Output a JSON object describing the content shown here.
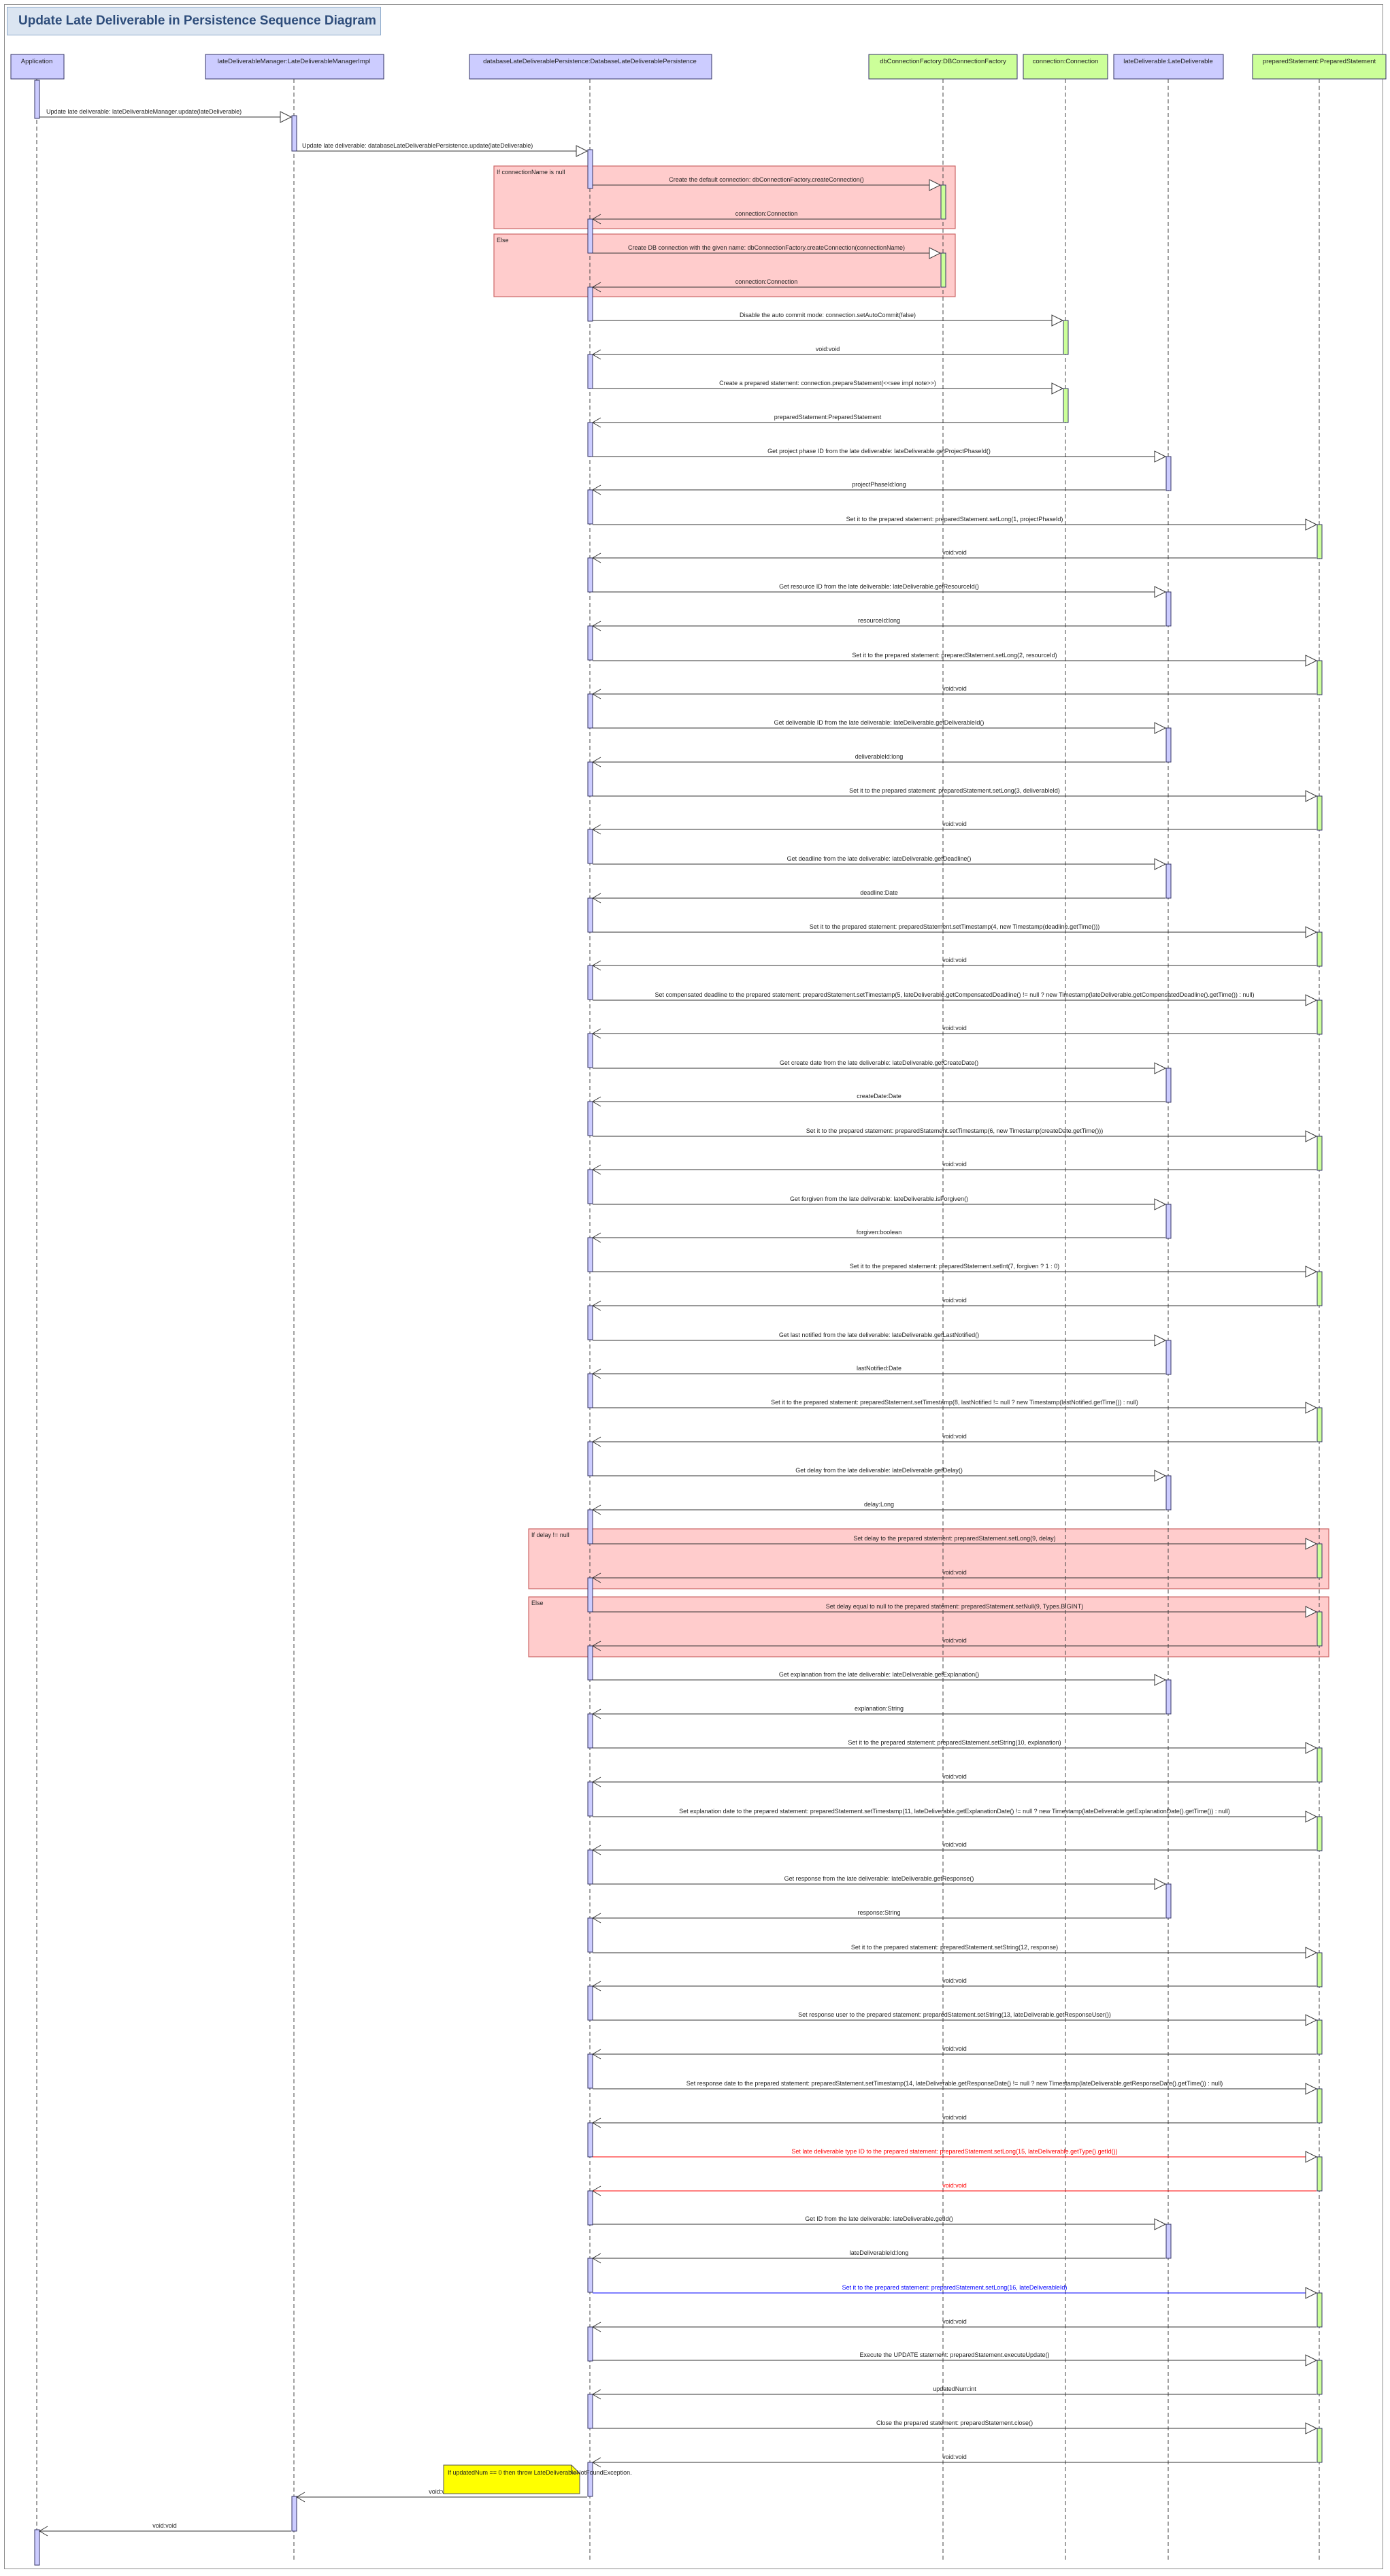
{
  "diagram": {
    "title": "Update Late Deliverable in Persistence Sequence Diagram",
    "colors": {
      "lifeline_blue": "#ccccff",
      "lifeline_green": "#ccff99",
      "fragment_fill": "#ffcccc",
      "fragment_border": "#cc6666",
      "note_fill": "#ffff00",
      "highlight_red": "#ff0000",
      "highlight_blue": "#0000ff"
    },
    "lifelines": [
      {
        "id": "app",
        "label": "Application",
        "color": "blue"
      },
      {
        "id": "mgr",
        "label": "lateDeliverableManager:LateDeliverableManagerImpl",
        "color": "blue"
      },
      {
        "id": "dbp",
        "label": "databaseLateDeliverablePersistence:DatabaseLateDeliverablePersistence",
        "color": "blue"
      },
      {
        "id": "dcf",
        "label": "dbConnectionFactory:DBConnectionFactory",
        "color": "green"
      },
      {
        "id": "con",
        "label": "connection:Connection",
        "color": "green"
      },
      {
        "id": "ld",
        "label": "lateDeliverable:LateDeliverable",
        "color": "blue"
      },
      {
        "id": "ps",
        "label": "preparedStatement:PreparedStatement",
        "color": "green"
      }
    ],
    "fragments": [
      {
        "guard": "If connectionName is null"
      },
      {
        "guard": "Else"
      },
      {
        "guard": "If delay != null"
      },
      {
        "guard": "Else"
      }
    ],
    "note": {
      "text": "If updatedNum == 0 then throw LateDeliverableNotFoundException."
    },
    "messages": [
      {
        "from": "app",
        "to": "mgr",
        "kind": "call",
        "text": "Update late deliverable: lateDeliverableManager.update(lateDeliverable)"
      },
      {
        "from": "mgr",
        "to": "dbp",
        "kind": "call",
        "text": "Update late deliverable: databaseLateDeliverablePersistence.update(lateDeliverable)"
      },
      {
        "from": "dbp",
        "to": "dcf",
        "kind": "call",
        "text": "Create the default connection: dbConnectionFactory.createConnection()"
      },
      {
        "from": "dcf",
        "to": "dbp",
        "kind": "return",
        "text": "connection:Connection"
      },
      {
        "from": "dbp",
        "to": "dcf",
        "kind": "call",
        "text": "Create DB connection with the given name: dbConnectionFactory.createConnection(connectionName)"
      },
      {
        "from": "dcf",
        "to": "dbp",
        "kind": "return",
        "text": "connection:Connection"
      },
      {
        "from": "dbp",
        "to": "con",
        "kind": "call",
        "text": "Disable the auto commit mode: connection.setAutoCommit(false)"
      },
      {
        "from": "con",
        "to": "dbp",
        "kind": "return",
        "text": "void:void"
      },
      {
        "from": "dbp",
        "to": "con",
        "kind": "call",
        "text": "Create a prepared statement: connection.prepareStatement(<<see impl note>>)"
      },
      {
        "from": "con",
        "to": "dbp",
        "kind": "return",
        "text": "preparedStatement:PreparedStatement"
      },
      {
        "from": "dbp",
        "to": "ld",
        "kind": "call",
        "text": "Get project phase ID from the late deliverable: lateDeliverable.getProjectPhaseId()"
      },
      {
        "from": "ld",
        "to": "dbp",
        "kind": "return",
        "text": "projectPhaseId:long"
      },
      {
        "from": "dbp",
        "to": "ps",
        "kind": "call",
        "text": "Set it to the prepared statement: preparedStatement.setLong(1, projectPhaseId)"
      },
      {
        "from": "ps",
        "to": "dbp",
        "kind": "return",
        "text": "void:void"
      },
      {
        "from": "dbp",
        "to": "ld",
        "kind": "call",
        "text": "Get resource ID from the late deliverable: lateDeliverable.getResourceId()"
      },
      {
        "from": "ld",
        "to": "dbp",
        "kind": "return",
        "text": "resourceId:long"
      },
      {
        "from": "dbp",
        "to": "ps",
        "kind": "call",
        "text": "Set it to the prepared statement: preparedStatement.setLong(2, resourceId)"
      },
      {
        "from": "ps",
        "to": "dbp",
        "kind": "return",
        "text": "void:void"
      },
      {
        "from": "dbp",
        "to": "ld",
        "kind": "call",
        "text": "Get deliverable ID from the late deliverable: lateDeliverable.getDeliverableId()"
      },
      {
        "from": "ld",
        "to": "dbp",
        "kind": "return",
        "text": "deliverableId:long"
      },
      {
        "from": "dbp",
        "to": "ps",
        "kind": "call",
        "text": "Set it to the prepared statement: preparedStatement.setLong(3, deliverableId)"
      },
      {
        "from": "ps",
        "to": "dbp",
        "kind": "return",
        "text": "void:void"
      },
      {
        "from": "dbp",
        "to": "ld",
        "kind": "call",
        "text": "Get deadline from the late deliverable: lateDeliverable.getDeadline()"
      },
      {
        "from": "ld",
        "to": "dbp",
        "kind": "return",
        "text": "deadline:Date"
      },
      {
        "from": "dbp",
        "to": "ps",
        "kind": "call",
        "text": "Set it to the prepared statement: preparedStatement.setTimestamp(4, new Timestamp(deadline.getTime()))"
      },
      {
        "from": "ps",
        "to": "dbp",
        "kind": "return",
        "text": "void:void"
      },
      {
        "from": "dbp",
        "to": "ps",
        "kind": "call",
        "text": "Set compensated deadline to the prepared statement: preparedStatement.setTimestamp(5, lateDeliverable.getCompensatedDeadline() != null ? new Timestamp(lateDeliverable.getCompensatedDeadline().getTime()) : null)"
      },
      {
        "from": "ps",
        "to": "dbp",
        "kind": "return",
        "text": "void:void"
      },
      {
        "from": "dbp",
        "to": "ld",
        "kind": "call",
        "text": "Get create date from the late deliverable: lateDeliverable.getCreateDate()"
      },
      {
        "from": "ld",
        "to": "dbp",
        "kind": "return",
        "text": "createDate:Date"
      },
      {
        "from": "dbp",
        "to": "ps",
        "kind": "call",
        "text": "Set it to the prepared statement: preparedStatement.setTimestamp(6, new Timestamp(createDate.getTime()))"
      },
      {
        "from": "ps",
        "to": "dbp",
        "kind": "return",
        "text": "void:void"
      },
      {
        "from": "dbp",
        "to": "ld",
        "kind": "call",
        "text": "Get forgiven from the late deliverable: lateDeliverable.isForgiven()"
      },
      {
        "from": "ld",
        "to": "dbp",
        "kind": "return",
        "text": "forgiven:boolean"
      },
      {
        "from": "dbp",
        "to": "ps",
        "kind": "call",
        "text": "Set it to the prepared statement: preparedStatement.setInt(7, forgiven ? 1 : 0)"
      },
      {
        "from": "ps",
        "to": "dbp",
        "kind": "return",
        "text": "void:void"
      },
      {
        "from": "dbp",
        "to": "ld",
        "kind": "call",
        "text": "Get last notified from the late deliverable: lateDeliverable.getLastNotified()"
      },
      {
        "from": "ld",
        "to": "dbp",
        "kind": "return",
        "text": "lastNotified:Date"
      },
      {
        "from": "dbp",
        "to": "ps",
        "kind": "call",
        "text": "Set it to the prepared statement: preparedStatement.setTimestamp(8, lastNotified != null ? new Timestamp(lastNotified.getTime()) : null)"
      },
      {
        "from": "ps",
        "to": "dbp",
        "kind": "return",
        "text": "void:void"
      },
      {
        "from": "dbp",
        "to": "ld",
        "kind": "call",
        "text": "Get delay from the late deliverable: lateDeliverable.getDelay()"
      },
      {
        "from": "ld",
        "to": "dbp",
        "kind": "return",
        "text": "delay:Long"
      },
      {
        "from": "dbp",
        "to": "ps",
        "kind": "call",
        "text": "Set delay to the prepared statement: preparedStatement.setLong(9, delay)"
      },
      {
        "from": "ps",
        "to": "dbp",
        "kind": "return",
        "text": "void:void"
      },
      {
        "from": "dbp",
        "to": "ps",
        "kind": "call",
        "text": "Set delay equal to null to the prepared statement: preparedStatement.setNull(9, Types.BIGINT)"
      },
      {
        "from": "ps",
        "to": "dbp",
        "kind": "return",
        "text": "void:void"
      },
      {
        "from": "dbp",
        "to": "ld",
        "kind": "call",
        "text": "Get explanation from the late deliverable: lateDeliverable.getExplanation()"
      },
      {
        "from": "ld",
        "to": "dbp",
        "kind": "return",
        "text": "explanation:String"
      },
      {
        "from": "dbp",
        "to": "ps",
        "kind": "call",
        "text": "Set it to the prepared statement: preparedStatement.setString(10, explanation)"
      },
      {
        "from": "ps",
        "to": "dbp",
        "kind": "return",
        "text": "void:void"
      },
      {
        "from": "dbp",
        "to": "ps",
        "kind": "call",
        "text": "Set explanation date to the prepared statement: preparedStatement.setTimestamp(11, lateDeliverable.getExplanationDate() != null ? new Timestamp(lateDeliverable.getExplanationDate().getTime()) : null)"
      },
      {
        "from": "ps",
        "to": "dbp",
        "kind": "return",
        "text": "void:void"
      },
      {
        "from": "dbp",
        "to": "ld",
        "kind": "call",
        "text": "Get response from the late deliverable: lateDeliverable.getResponse()"
      },
      {
        "from": "ld",
        "to": "dbp",
        "kind": "return",
        "text": "response:String"
      },
      {
        "from": "dbp",
        "to": "ps",
        "kind": "call",
        "text": "Set it to the prepared statement: preparedStatement.setString(12, response)"
      },
      {
        "from": "ps",
        "to": "dbp",
        "kind": "return",
        "text": "void:void"
      },
      {
        "from": "dbp",
        "to": "ps",
        "kind": "call",
        "text": "Set response user to the prepared statement: preparedStatement.setString(13, lateDeliverable.getResponseUser())"
      },
      {
        "from": "ps",
        "to": "dbp",
        "kind": "return",
        "text": "void:void"
      },
      {
        "from": "dbp",
        "to": "ps",
        "kind": "call",
        "text": "Set response date to the prepared statement: preparedStatement.setTimestamp(14, lateDeliverable.getResponseDate() != null ? new Timestamp(lateDeliverable.getResponseDate().getTime()) : null)"
      },
      {
        "from": "ps",
        "to": "dbp",
        "kind": "return",
        "text": "void:void"
      },
      {
        "from": "dbp",
        "to": "ps",
        "kind": "call",
        "text": "Set late deliverable type ID to the prepared statement: preparedStatement.setLong(15, lateDeliverable.getType().getId())",
        "color": "red"
      },
      {
        "from": "ps",
        "to": "dbp",
        "kind": "return",
        "text": "void:void",
        "color": "red"
      },
      {
        "from": "dbp",
        "to": "ld",
        "kind": "call",
        "text": "Get ID from the late deliverable: lateDeliverable.getId()"
      },
      {
        "from": "ld",
        "to": "dbp",
        "kind": "return",
        "text": "lateDeliverableId:long"
      },
      {
        "from": "dbp",
        "to": "ps",
        "kind": "call",
        "text": "Set it to the prepared statement: preparedStatement.setLong(16, lateDeliverableId)",
        "color": "blue"
      },
      {
        "from": "ps",
        "to": "dbp",
        "kind": "return",
        "text": "void:void"
      },
      {
        "from": "dbp",
        "to": "ps",
        "kind": "call",
        "text": "Execute the UPDATE statement: preparedStatement.executeUpdate()"
      },
      {
        "from": "ps",
        "to": "dbp",
        "kind": "return",
        "text": "updatedNum:int"
      },
      {
        "from": "dbp",
        "to": "ps",
        "kind": "call",
        "text": "Close the prepared statement: preparedStatement.close()"
      },
      {
        "from": "ps",
        "to": "dbp",
        "kind": "return",
        "text": "void:void"
      },
      {
        "from": "dbp",
        "to": "mgr",
        "kind": "return",
        "text": "void:void"
      },
      {
        "from": "mgr",
        "to": "app",
        "kind": "return",
        "text": "void:void"
      }
    ]
  }
}
